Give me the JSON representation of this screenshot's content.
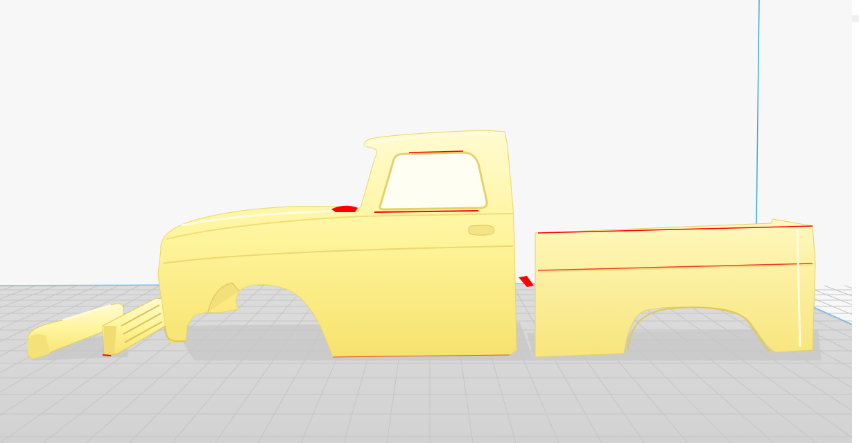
{
  "viewer": {
    "view": "side",
    "colors": {
      "background": "#f7f7f7",
      "build_plate": "#d9d9d9",
      "grid_line": "#c2c2c2",
      "axis_z": "#3aa7e0",
      "axis_x": "#6ab8e8",
      "model": "#fff3a0",
      "model_shade": "#f3e17a",
      "model_dark": "#c9b94f",
      "overhang": "#ff0000"
    }
  },
  "models": [
    {
      "name": "front-bumper"
    },
    {
      "name": "grille"
    },
    {
      "name": "cab-body"
    },
    {
      "name": "truck-bed"
    }
  ]
}
